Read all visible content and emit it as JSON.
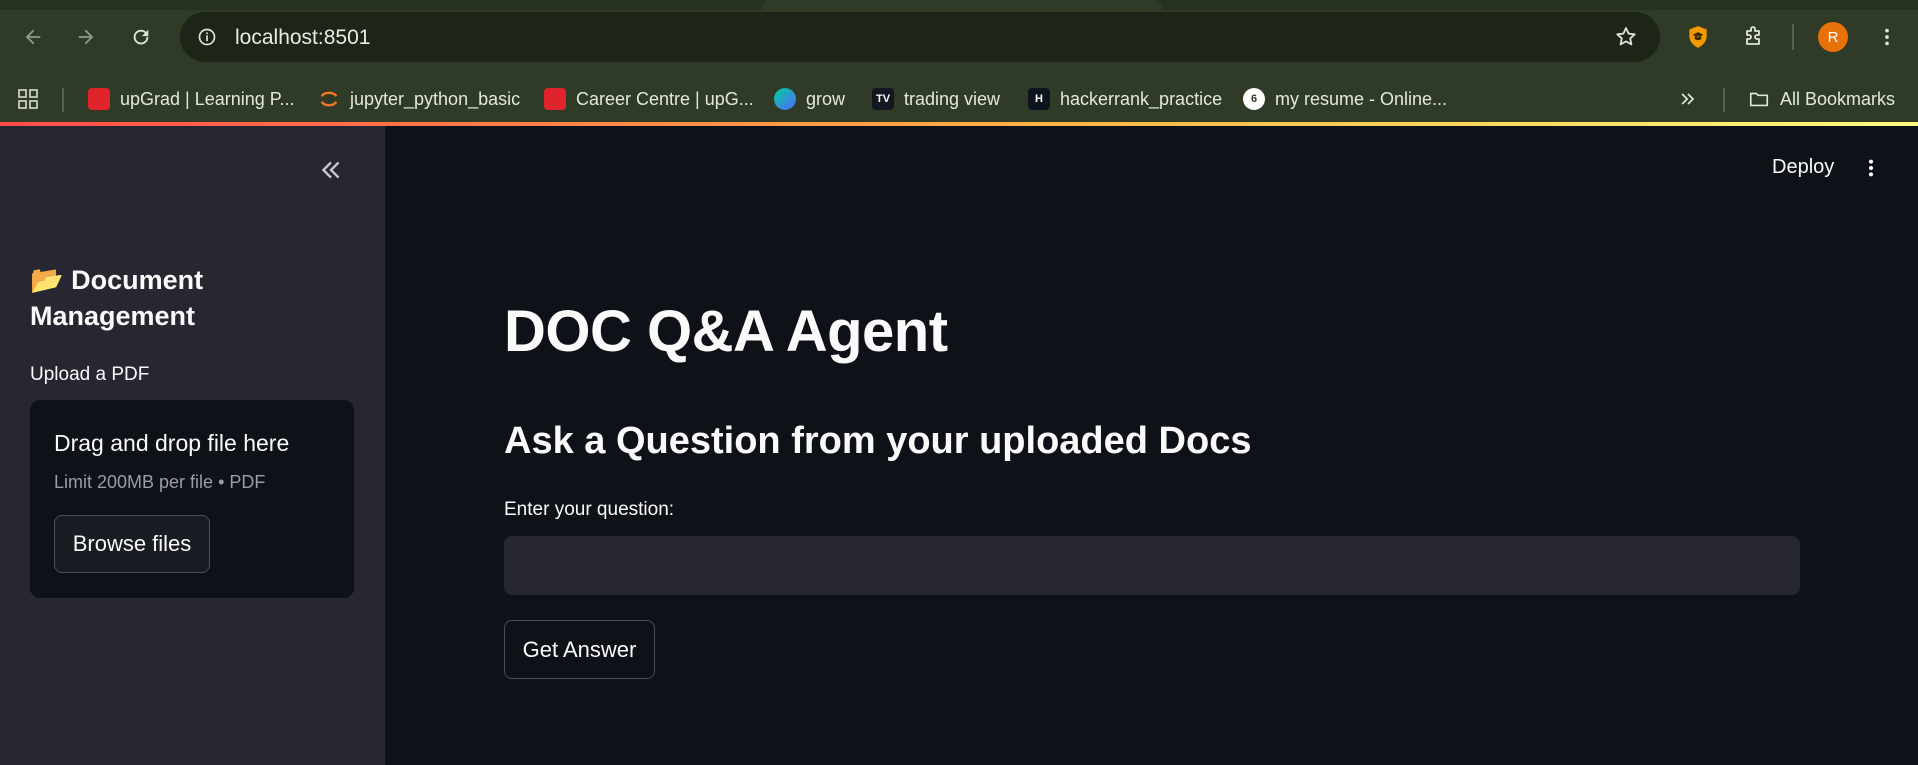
{
  "browser": {
    "url": "localhost:8501",
    "icons": [
      "back-arrow-icon",
      "forward-arrow-icon",
      "reload-icon",
      "site-info-icon",
      "bookmark-star-icon",
      "shield-extension-icon",
      "extensions-puzzle-icon",
      "kebab-menu-icon"
    ],
    "avatar_initial": "R",
    "bookmarks": [
      {
        "label": "upGrad | Learning P...",
        "icon": "upgrad-favicon",
        "color": "#e0242b"
      },
      {
        "label": "jupyter_python_basic",
        "icon": "jupyter-favicon",
        "color": "#f37726"
      },
      {
        "label": "Career Centre | upG...",
        "icon": "upgrad-favicon",
        "color": "#e0242b"
      },
      {
        "label": "grow",
        "icon": "grow-favicon",
        "color": "#5367ff"
      },
      {
        "label": "trading view",
        "icon": "tradingview-favicon",
        "color": "#131722"
      },
      {
        "label": "hackerrank_practice",
        "icon": "hackerrank-favicon",
        "color": "#1ba94c"
      },
      {
        "label": "my resume - Online...",
        "icon": "resume-favicon",
        "color": "#ffffff"
      }
    ],
    "all_bookmarks_label": "All Bookmarks"
  },
  "sidebar": {
    "heading_emoji": "📂",
    "heading": "Document Management",
    "upload_label": "Upload a PDF",
    "dropzone_title": "Drag and drop file here",
    "dropzone_limit": "Limit 200MB per file • PDF",
    "browse_label": "Browse files"
  },
  "header": {
    "deploy_label": "Deploy"
  },
  "main": {
    "title": "DOC Q&A Agent",
    "subheader": "Ask a Question from your uploaded Docs",
    "question_label": "Enter your question:",
    "question_value": "",
    "button_label": "Get Answer"
  },
  "colors": {
    "chrome_bg": "#2f3b26",
    "app_bg": "#0e1117",
    "sidebar_bg": "#262730",
    "accent": "#ff4b4b"
  }
}
